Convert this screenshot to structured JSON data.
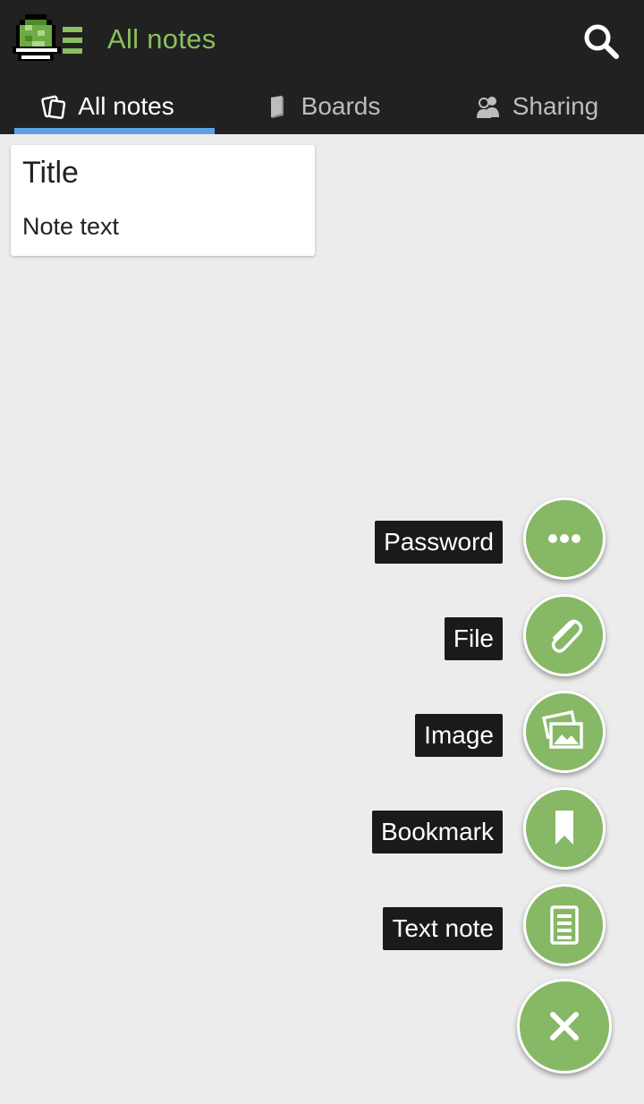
{
  "app": {
    "title": "All notes",
    "logo_icon": "turtle-logo-icon",
    "accent_color": "#8bbf5f",
    "fab_color": "#86b865",
    "tab_indicator_color": "#5da1e8"
  },
  "tabs": [
    {
      "label": "All notes",
      "icon": "notes-icon",
      "active": true
    },
    {
      "label": "Boards",
      "icon": "book-icon",
      "active": false
    },
    {
      "label": "Sharing",
      "icon": "people-icon",
      "active": false
    }
  ],
  "notes": [
    {
      "title": "Title",
      "text": "Note text"
    }
  ],
  "fab_menu": {
    "items": [
      {
        "label": "Password",
        "icon": "more-dots-icon"
      },
      {
        "label": "File",
        "icon": "paperclip-icon"
      },
      {
        "label": "Image",
        "icon": "image-icon"
      },
      {
        "label": "Bookmark",
        "icon": "bookmark-icon"
      },
      {
        "label": "Text note",
        "icon": "text-note-icon"
      }
    ],
    "close_icon": "close-icon"
  }
}
